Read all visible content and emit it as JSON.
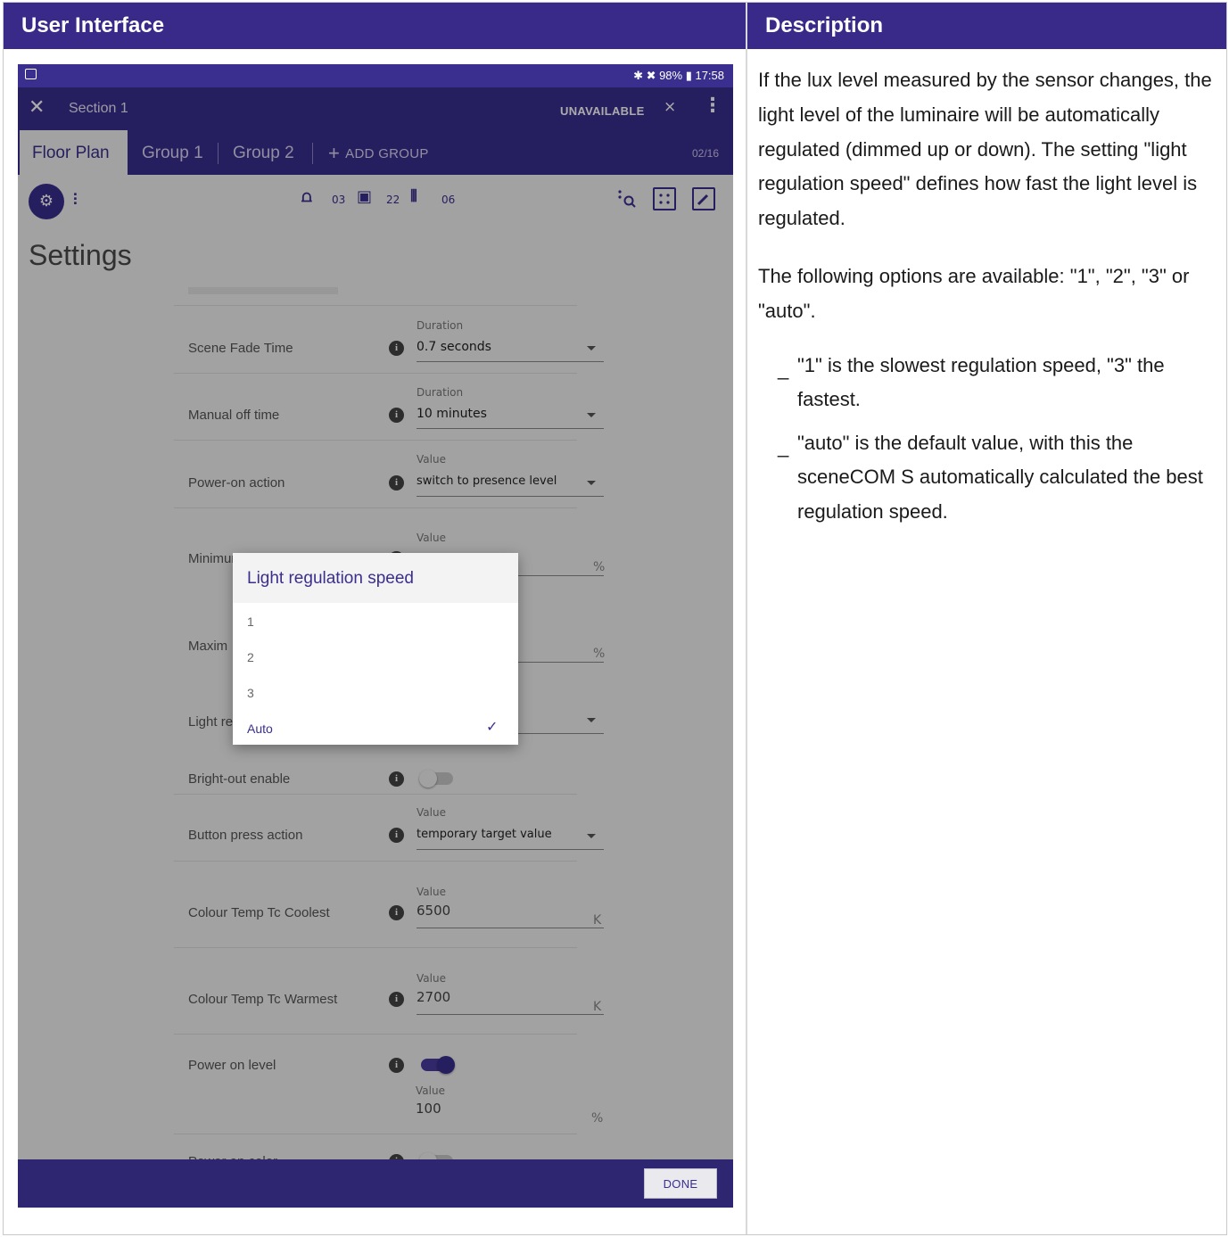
{
  "table": {
    "left_header": "User Interface",
    "right_header": "Description"
  },
  "statusbar": {
    "right_text": "✱ ✖ 98% ▮ 17:58"
  },
  "appbar": {
    "close_glyph": "✕",
    "title": "Section 1",
    "status": "UNAVAILABLE",
    "signal_glyph": "⨯",
    "more_glyph": "⋮"
  },
  "tabs": {
    "items": [
      {
        "label": "Floor Plan",
        "active": true
      },
      {
        "label": "Group 1",
        "active": false
      },
      {
        "label": "Group 2",
        "active": false
      }
    ],
    "add_label": "ADD GROUP",
    "add_glyph": "+",
    "count": "02/16"
  },
  "toolbar": {
    "gear_glyph": "⚙",
    "sliders_glyph": "⫶",
    "luminaires_glyph": "⩍",
    "luminaires_count": "03",
    "sensors_glyph": "▣",
    "sensors_count": "22",
    "signal_glyph": "⦀",
    "signal_count": "06",
    "right_icons": [
      "search-dots-icon",
      "grid-select-icon",
      "edit-icon"
    ]
  },
  "page": {
    "title": "Settings"
  },
  "settings": {
    "scene_fade": {
      "label": "Scene Fade Time",
      "caption": "Duration",
      "value": "0.7 seconds"
    },
    "manual_off": {
      "label": "Manual off time",
      "caption": "Duration",
      "value": "10 minutes"
    },
    "power_on_action": {
      "label": "Power-on action",
      "caption": "Value",
      "value": "switch to presence level"
    },
    "min_light": {
      "label": "Minimum light level",
      "caption": "Value",
      "unit": "%"
    },
    "max_light": {
      "label": "Maxim",
      "unit": "%"
    },
    "light_reg": {
      "label": "Light re"
    },
    "bright_out": {
      "label": "Bright-out enable",
      "on": false
    },
    "button_press": {
      "label": "Button press action",
      "caption": "Value",
      "value": "temporary target value"
    },
    "tc_coolest": {
      "label": "Colour Temp Tc Coolest",
      "caption": "Value",
      "value": "6500",
      "unit": "K"
    },
    "tc_warmest": {
      "label": "Colour Temp Tc Warmest",
      "caption": "Value",
      "value": "2700",
      "unit": "K"
    },
    "power_on_level": {
      "label": "Power on level",
      "on": true,
      "caption": "Value",
      "value": "100",
      "unit": "%"
    },
    "power_on_color": {
      "label": "Power on color"
    }
  },
  "dialog": {
    "title": "Light regulation speed",
    "options": [
      "1",
      "2",
      "3",
      "Auto"
    ],
    "selected": "Auto",
    "check_glyph": "✓"
  },
  "bottombar": {
    "done_label": "DONE"
  },
  "description": {
    "p1": "If the lux level measured by the sensor changes, the light level of the luminaire will be automatically regulated (dimmed up or down). The setting \"light regulation speed\" defines how fast the light level is regulated.",
    "p2": "The following options are available: \"1\", \"2\", \"3\" or \"auto\".",
    "bullet_marker": "_",
    "bullets": [
      "\"1\" is the slowest regulation speed, \"3\" the fastest.",
      "\"auto\" is the default value, with this the sceneCOM S automatically calculated the best regulation speed."
    ]
  },
  "colors": {
    "brand": "#392a8a",
    "app_bar": "#3a2f8e",
    "bottom_bar": "#2e2671"
  }
}
